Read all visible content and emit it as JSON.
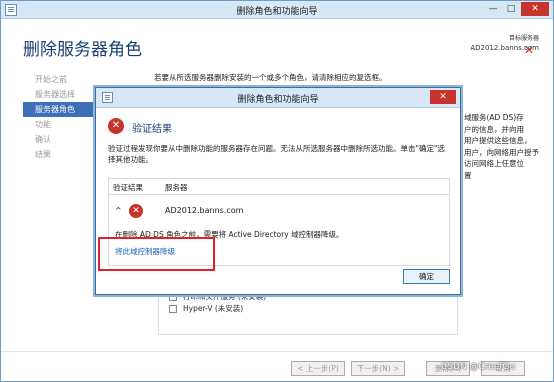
{
  "wizard": {
    "title": "删除角色和功能向导",
    "heading": "删除服务器角色",
    "target_label": "目标服务器",
    "target_server": "AD2012.banns.com",
    "window_buttons": {
      "minimize": "—",
      "maximize": "□",
      "close": "✕"
    },
    "close_x": "✕",
    "sidebar": [
      {
        "label": "开始之前",
        "active": false
      },
      {
        "label": "服务器选择",
        "active": false
      },
      {
        "label": "服务器角色",
        "active": true
      },
      {
        "label": "功能",
        "active": false
      },
      {
        "label": "确认",
        "active": false
      },
      {
        "label": "结果",
        "active": false
      }
    ],
    "instruction": "若要从所选服务器删除安装的一个或多个角色，请清除相应的复选框。",
    "right_peek": [
      "域服务(AD DS)存",
      "户的信息，并向用",
      "用户提供这些信息，",
      "用户，向网络用户授予",
      "访问网络上任意位",
      "置"
    ],
    "roles": [
      {
        "label": "打印和文件服务 (未安装)"
      },
      {
        "label": "Hyper-V (未安装)"
      }
    ],
    "footer": {
      "prev": "< 上一步(P)",
      "next": "下一步(N) >",
      "remove": "删除(R)",
      "cancel": "取消"
    },
    "watermark": "CSDN @CreefGu"
  },
  "dialog": {
    "title": "删除角色和功能向导",
    "close": "✕",
    "heading": "验证结果",
    "description": "验证过程发现你要从中删除功能的服务器存在问题。无法从所选服务器中删除所选功能。单击\"确定\"选择其他功能。",
    "columns": {
      "result": "验证结果",
      "server": "服务器"
    },
    "row": {
      "chevron": "^",
      "server": "AD2012.banns.com",
      "message": "在删除 AD DS 角色之前，需要将 Active Directory 域控制器降级。",
      "link": "将此域控制器降级"
    },
    "ok": "确定"
  },
  "colors": {
    "accent": "#3f6fb8",
    "error": "#c7342e",
    "highlight": "#e0202a",
    "link": "#1d5fb3"
  }
}
